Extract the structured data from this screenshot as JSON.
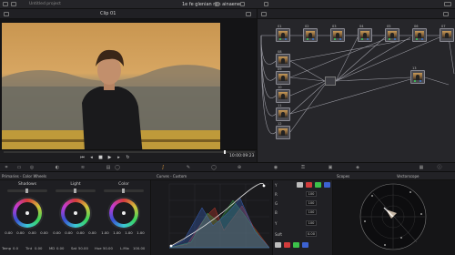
{
  "window": {
    "title": "1e fe glenian ren ainaene",
    "saved_label": "Untitled project"
  },
  "viewer": {
    "clip_label": "Clip 01",
    "timecode": "10:00:09:23"
  },
  "transport": {
    "icons": [
      "skip-start-icon",
      "step-back-icon",
      "stop-icon",
      "play-icon",
      "step-forward-icon",
      "loop-icon"
    ]
  },
  "nodes": {
    "labels": [
      "01",
      "02",
      "03",
      "04",
      "05",
      "06",
      "07",
      "08",
      "09",
      "10",
      "11",
      "12",
      "13",
      "14",
      "15"
    ]
  },
  "toolbar": {
    "active_tool": "curves-tool"
  },
  "headers": {
    "wheels_title": "Primaries - Color Wheels",
    "curves_title": "Curves - Custom",
    "scope_title": "Scopes",
    "scope_mode": "Vectorscope"
  },
  "wheels": [
    {
      "name": "Shadows",
      "values": [
        "0.00",
        "0.00",
        "0.00",
        "0.00"
      ]
    },
    {
      "name": "Light",
      "values": [
        "0.00",
        "0.00",
        "0.00",
        "0.00"
      ]
    },
    {
      "name": "Color",
      "values": [
        "1.00",
        "1.00",
        "1.00",
        "1.00"
      ]
    }
  ],
  "wheel_footer": {
    "temp_label": "Temp",
    "temp_value": "0.0",
    "tint_label": "Tint",
    "tint_value": "0.00",
    "md_label": "MD",
    "md_value": "0.00",
    "sat_label": "Sat",
    "sat_value": "50.00",
    "hue_label": "Hue",
    "hue_value": "50.00",
    "lum_label": "L.Mix",
    "lum_value": "100.00"
  },
  "curve_panel": {
    "rows": [
      {
        "label": "Y",
        "value": "100"
      },
      {
        "label": "R",
        "value": "100"
      },
      {
        "label": "G",
        "value": "100"
      },
      {
        "label": "B",
        "value": "100"
      },
      {
        "label": "Soft",
        "value": "0.00"
      }
    ]
  },
  "colors": {
    "accent": "#e09a3a",
    "node_border": "#8a8a92",
    "curve_line": "#e6e6e6"
  },
  "chart_data": {
    "type": "area",
    "series": [
      {
        "name": "Red"
      },
      {
        "name": "Green"
      },
      {
        "name": "Blue"
      }
    ]
  }
}
